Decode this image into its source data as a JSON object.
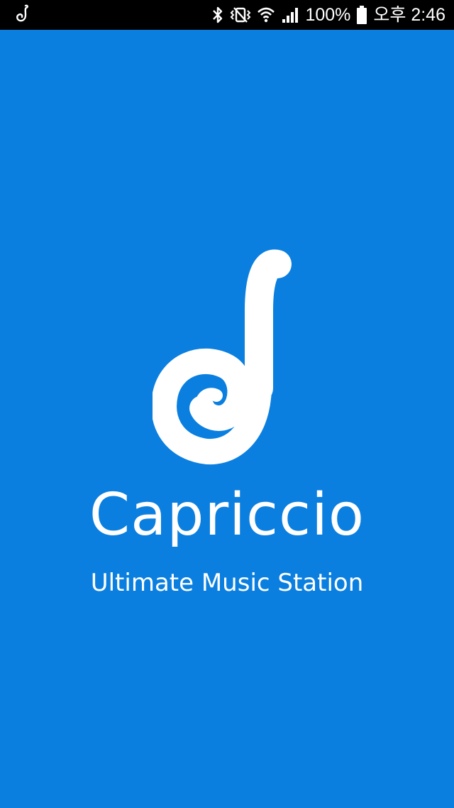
{
  "status_bar": {
    "notification_icon": "capriccio-app-icon",
    "icons": [
      "bluetooth-icon",
      "vibrate-icon",
      "wifi-icon",
      "signal-icon",
      "battery-icon"
    ],
    "battery": "100%",
    "time": "오후 2:46"
  },
  "splash": {
    "background_color": "#0a7fe0",
    "logo_icon": "capriccio-swirl-note-icon",
    "app_name": "Capriccio",
    "tagline": "Ultimate Music Station"
  }
}
